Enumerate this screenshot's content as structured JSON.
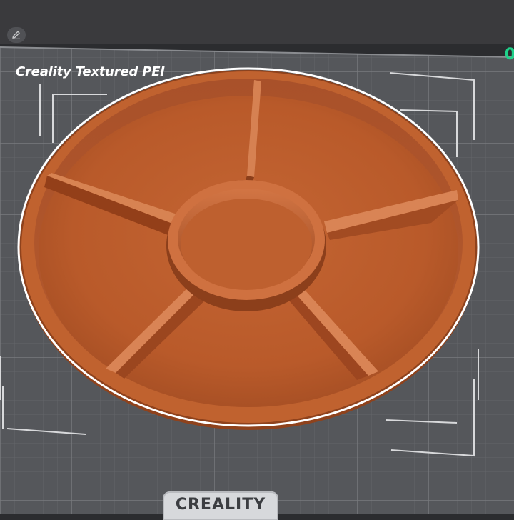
{
  "toolbar": {
    "edit_icon": "pencil-icon",
    "corner_readout": "0"
  },
  "plate": {
    "title": "Creality Textured PEI",
    "logo": "CREALITY"
  },
  "model": {
    "name": "divided round tray",
    "compartments": 5,
    "color": "#b75a2c"
  },
  "colors": {
    "bed": "#55575b",
    "grid": "#707276",
    "model": "#b75a2c",
    "outline": "#ffffff",
    "accent": "#1fd18a"
  }
}
